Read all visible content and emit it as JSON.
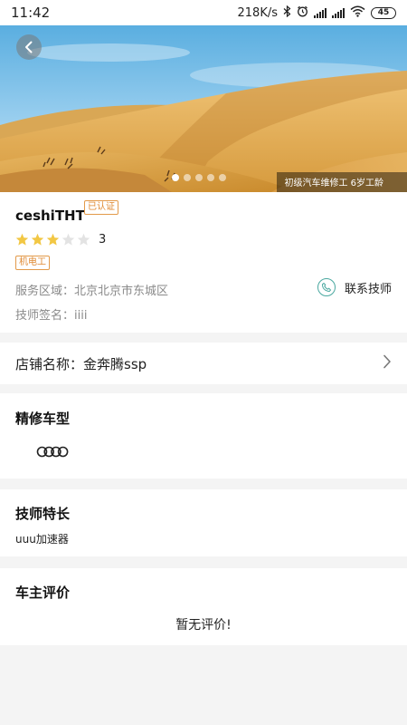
{
  "status_bar": {
    "time": "11:42",
    "network_speed": "218K/s",
    "battery": "45",
    "icons": [
      "bluetooth-icon",
      "alarm-icon",
      "signal-icon",
      "signal-icon",
      "wifi-icon",
      "battery-icon"
    ]
  },
  "hero": {
    "caption": "初级汽车维修工 6岁工龄",
    "slide_count": 5,
    "active_slide": 1
  },
  "technician": {
    "name": "ceshiTHT",
    "verified_badge": "已认证",
    "rating": 3,
    "rating_max": 5,
    "rating_text": "3",
    "tag": "机电工",
    "service_area": "服务区域：北京北京市东城区",
    "signature": "技师签名：iiii",
    "contact_label": "联系技师"
  },
  "shop": {
    "label": "店铺名称：金奔腾ssp"
  },
  "models": {
    "title": "精修车型",
    "brands": [
      "audi-logo"
    ]
  },
  "specialty": {
    "title": "技师特长",
    "text": "uuu加速器"
  },
  "reviews": {
    "title": "车主评价",
    "empty_text": "暂无评价!"
  },
  "colors": {
    "accent_orange": "#e08a33",
    "star_gold": "#f2c744",
    "phone_teal": "#4aa8a0"
  }
}
